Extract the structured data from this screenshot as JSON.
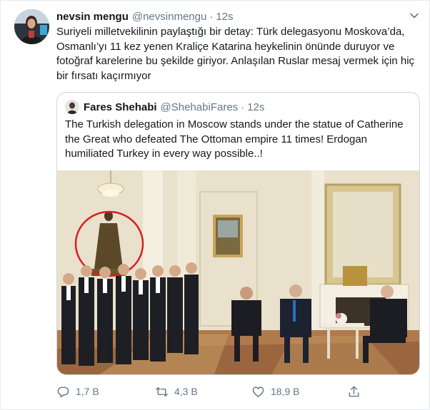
{
  "tweet": {
    "author_name": "nevsin mengu",
    "handle": "@nevsinmengu",
    "separator": "·",
    "time": "12s",
    "text": "Suriyeli milletvekilinin paylaştığı bir detay: Türk delegasyonu Moskova’da, Osmanlı’yı 11 kez yenen Kraliçe Katarina heykelinin önünde duruyor ve fotoğraf karelerine bu şekilde giriyor. Anlaşılan Ruslar mesaj vermek için hiç bir fırsatı kaçırmıyor"
  },
  "quoted_tweet": {
    "author_name": "Fares Shehabi",
    "handle": "@ShehabiFares",
    "separator": "·",
    "time": "12s",
    "text": "The Turkish delegation in Moscow stands under the statue of Catherine the Great who defeated The Ottoman empire 11 times! Erdogan humiliated Turkey in every way possible..!"
  },
  "actions": {
    "reply_count": "1,7 B",
    "retweet_count": "4,3 B",
    "like_count": "18,9 B"
  },
  "icons": {
    "caret": "chevron-down-icon",
    "reply": "reply-icon",
    "retweet": "retweet-icon",
    "like": "heart-icon",
    "share": "share-icon"
  },
  "colors": {
    "text": "#14171a",
    "secondary": "#657786",
    "border": "#e6ecf0",
    "quote_border": "#ccd6dd",
    "highlight_circle": "#d61f26"
  }
}
